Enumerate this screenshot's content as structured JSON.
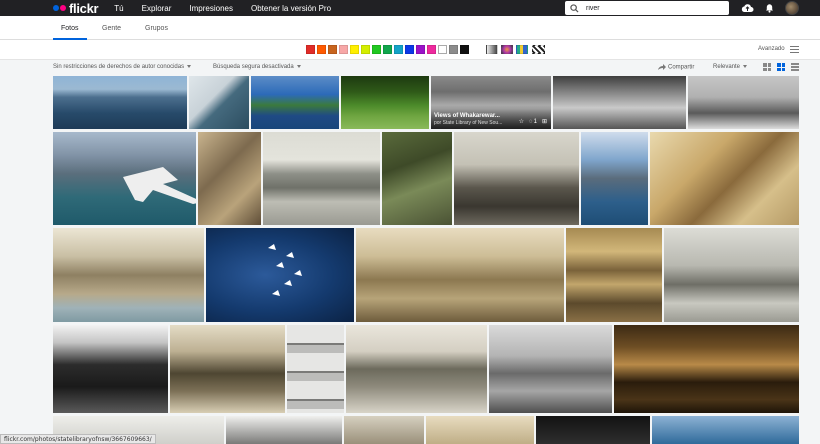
{
  "topnav": {
    "logo": "flickr",
    "links": [
      "Tú",
      "Explorar",
      "Impresiones",
      "Obtener la versión Pro"
    ],
    "search_value": "river",
    "icons": [
      "upload-icon",
      "bell-icon",
      "avatar"
    ]
  },
  "tabs": [
    {
      "label": "Fotos",
      "active": true
    },
    {
      "label": "Gente",
      "active": false
    },
    {
      "label": "Grupos",
      "active": false
    }
  ],
  "color_filters": [
    "#e12c28",
    "#ff5a00",
    "#c8641e",
    "#f7a7a7",
    "#ffef00",
    "#d4ee00",
    "#21c821",
    "#11a64c",
    "#13a3c7",
    "#0c38e8",
    "#9b12c8",
    "#ee2a9e",
    "#ffffff",
    "#8c8c8c",
    "#111111"
  ],
  "style_filters": [
    "black-and-white-icon",
    "shallow-depth-icon",
    "minimalism-icon",
    "patterns-icon"
  ],
  "advanced": {
    "label": "Avanzado"
  },
  "options": {
    "license": "Sin restricciones de derechos de autor conocidas",
    "safe_search": "Búsqueda segura desactivada",
    "share": "Compartir",
    "sort": "Relevante"
  },
  "hover_photo": {
    "title": "Views of Whakarewar...",
    "by": "por State Library of New Sou...",
    "comments": "1"
  },
  "status_url": "flickr.com/photos/statelibraryofnsw/3667609663/",
  "colors": {
    "nav_bg": "#212124",
    "accent": "#0063dc",
    "page_bg": "#f3f5f6"
  }
}
